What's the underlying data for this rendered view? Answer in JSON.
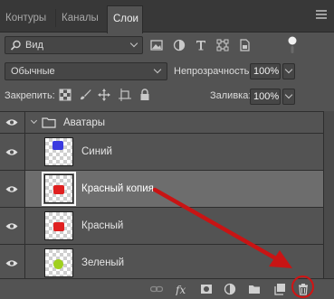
{
  "tabs": [
    {
      "label": "Контуры",
      "active": false
    },
    {
      "label": "Каналы",
      "active": false
    },
    {
      "label": "Слои",
      "active": true
    }
  ],
  "filter": {
    "label": "Вид"
  },
  "blend_mode": "Обычные",
  "opacity": {
    "label": "Непрозрачность:",
    "value": "100%"
  },
  "lock": {
    "label": "Закрепить:"
  },
  "fill": {
    "label": "Заливка:",
    "value": "100%"
  },
  "layers": [
    {
      "name": "Аватары",
      "type": "group"
    },
    {
      "name": "Синий",
      "type": "layer",
      "color": "#3a3ae0"
    },
    {
      "name": "Красный копия",
      "type": "layer",
      "color": "#e02020",
      "selected": true
    },
    {
      "name": "Красный",
      "type": "layer",
      "color": "#e02020"
    },
    {
      "name": "Зеленый",
      "type": "layer",
      "color": "#a0d020"
    }
  ],
  "bottom_icons": [
    "link-icon",
    "fx-icon",
    "mask-icon",
    "adjustment-icon",
    "folder-icon",
    "new-layer-icon",
    "trash-icon"
  ],
  "colors": {
    "panel": "#535353",
    "tabbar": "#383838",
    "selected_row": "#6d6d6d",
    "annotation_red": "#d01414"
  }
}
